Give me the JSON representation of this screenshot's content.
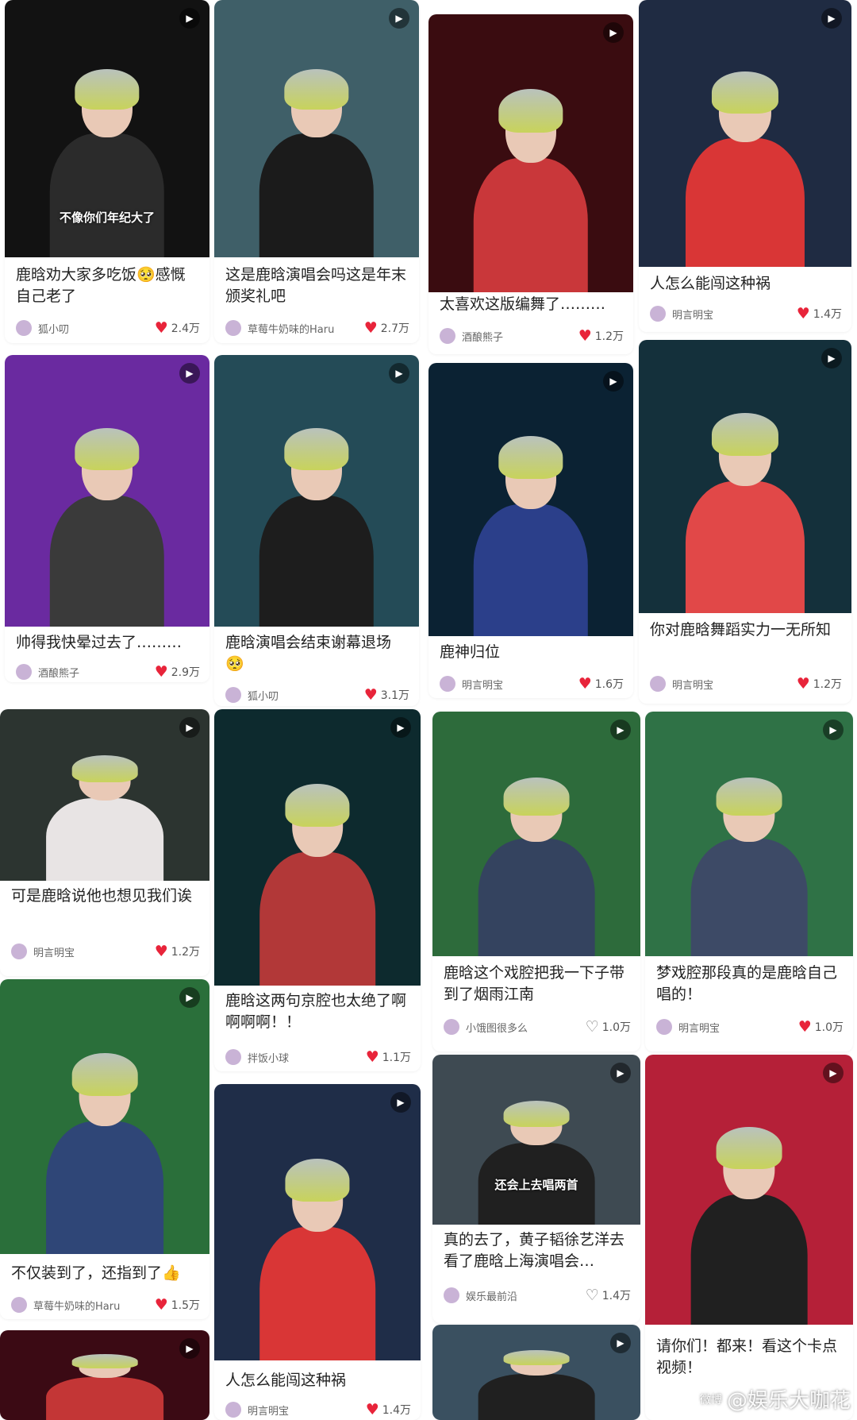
{
  "cards": [
    {
      "title": "鹿晗劝大家多吃饭🥺感慨自己老了",
      "author": "狐小叨",
      "likes": "2.4万",
      "liked": true,
      "thumb_bg": "#121212",
      "fig_color": "#2b2b2b",
      "caption_overlay": "不像你们年纪大了"
    },
    {
      "title": "这是鹿晗演唱会吗这是年末颁奖礼吧",
      "author": "草莓牛奶味的Haru",
      "likes": "2.7万",
      "liked": true,
      "thumb_bg": "#3f5f68",
      "fig_color": "#1b1b1b"
    },
    {
      "title": "太喜欢这版编舞了………",
      "author": "酒酿熊子",
      "likes": "1.2万",
      "liked": true,
      "thumb_bg": "#3a0c10",
      "fig_color": "#c9373a"
    },
    {
      "title": "人怎么能闯这种祸",
      "author": "明言明宝",
      "likes": "1.4万",
      "liked": true,
      "thumb_bg": "#1f2b42",
      "fig_color": "#d93636"
    },
    {
      "title": "帅得我快晕过去了………",
      "author": "酒酿熊子",
      "likes": "2.9万",
      "liked": true,
      "thumb_bg": "#6a2aa0",
      "fig_color": "#3a3a3a"
    },
    {
      "title": "鹿晗演唱会结束谢幕退场🥺",
      "author": "狐小叨",
      "likes": "3.1万",
      "liked": true,
      "thumb_bg": "#244b57",
      "fig_color": "#1d1d1d"
    },
    {
      "title": "鹿神归位",
      "author": "明言明宝",
      "likes": "1.6万",
      "liked": true,
      "thumb_bg": "#0b2233",
      "fig_color": "#2b3f8a"
    },
    {
      "title": "你对鹿晗舞蹈实力一无所知",
      "author": "明言明宝",
      "likes": "1.2万",
      "liked": true,
      "thumb_bg": "#14303b",
      "fig_color": "#e14848"
    },
    {
      "title": "可是鹿晗说他也想见我们诶",
      "author": "明言明宝",
      "likes": "1.2万",
      "liked": true,
      "thumb_bg": "#2c3430",
      "fig_color": "#e8e4e4"
    },
    {
      "title": "鹿晗这两句京腔也太绝了啊啊啊啊！！",
      "author": "拌饭小球",
      "likes": "1.1万",
      "liked": true,
      "thumb_bg": "#0d2a2e",
      "fig_color": "#b23838"
    },
    {
      "title": "鹿晗这个戏腔把我一下子带到了烟雨江南",
      "author": "小饿图很多么",
      "likes": "1.0万",
      "liked": false,
      "thumb_bg": "#2d6b3b",
      "fig_color": "#34435f"
    },
    {
      "title": "梦戏腔那段真的是鹿晗自己唱的！",
      "author": "明言明宝",
      "likes": "1.0万",
      "liked": true,
      "thumb_bg": "#2f7246",
      "fig_color": "#3d4a66"
    },
    {
      "title": "不仅装到了，还指到了👍",
      "author": "草莓牛奶味的Haru",
      "likes": "1.5万",
      "liked": true,
      "thumb_bg": "#2a6f3a",
      "fig_color": "#2f4677"
    },
    {
      "title": "人怎么能闯这种祸",
      "author": "明言明宝",
      "likes": "1.4万",
      "liked": true,
      "thumb_bg": "#1f2d48",
      "fig_color": "#d93636"
    },
    {
      "title": "真的去了，黄子韬徐艺洋去看了鹿晗上海演唱会…",
      "author": "娱乐最前沿",
      "likes": "1.4万",
      "liked": false,
      "thumb_bg": "#3e4a52",
      "fig_color": "#202020",
      "caption_overlay": "还会上去唱两首"
    },
    {
      "title": "请你们！都来！看这个卡点视频！",
      "author": "",
      "likes": "",
      "liked": true,
      "thumb_bg": "#b52038",
      "fig_color": "#202020"
    },
    {
      "title": "",
      "author": "",
      "likes": "",
      "liked": true,
      "thumb_bg": "#3b0a14",
      "fig_color": "#c33636"
    },
    {
      "title": "",
      "author": "",
      "likes": "",
      "liked": true,
      "thumb_bg": "#3a5060",
      "fig_color": "#202020"
    }
  ],
  "watermark": {
    "text": "@娱乐大咖花",
    "logo": "微博"
  },
  "play_glyph": "▶",
  "heart_glyph": "♥",
  "heart_outline_glyph": "♡"
}
